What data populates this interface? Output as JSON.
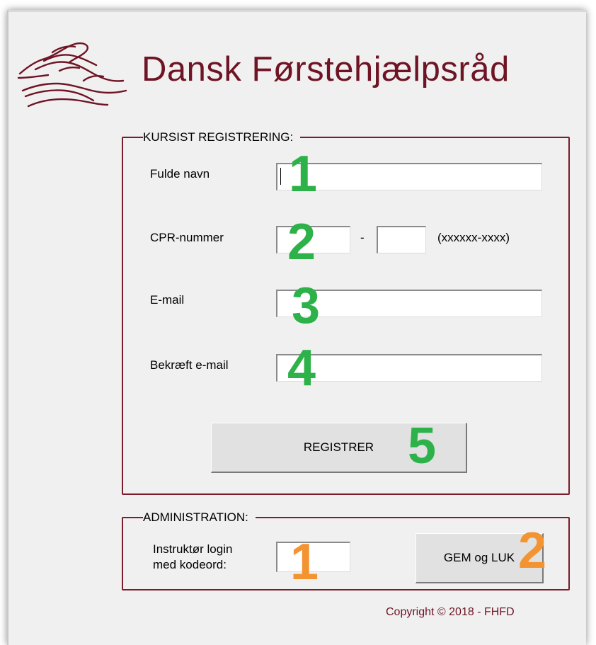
{
  "brand": {
    "title": "Dansk Førstehjælpsråd",
    "logo": "hands-logo-icon"
  },
  "registration": {
    "legend": "KURSIST REGISTRERING:",
    "full_name_label": "Fulde navn",
    "full_name_value": "",
    "cpr_label": "CPR-nummer",
    "cpr_part1_value": "",
    "cpr_separator": "-",
    "cpr_part2_value": "",
    "cpr_format_hint": "(xxxxxx-xxxx)",
    "email_label": "E-mail",
    "email_value": "",
    "confirm_email_label": "Bekræft e-mail",
    "confirm_email_value": "",
    "register_button": "REGISTRER"
  },
  "administration": {
    "legend": "ADMINISTRATION:",
    "login_label_line1": "Instruktør login",
    "login_label_line2": "med kodeord:",
    "password_value": "",
    "save_close_button": "GEM og LUK"
  },
  "annotations": {
    "green": [
      "1",
      "2",
      "3",
      "4",
      "5"
    ],
    "orange": [
      "1",
      "2"
    ]
  },
  "footer": {
    "copyright": "Copyright © 2018 - FHFD"
  },
  "colors": {
    "brand": "#6e1424",
    "frame": "#7a1c2c",
    "annotation_green": "#2db24a",
    "annotation_orange": "#f39433",
    "window_bg": "#f0f0f0"
  }
}
